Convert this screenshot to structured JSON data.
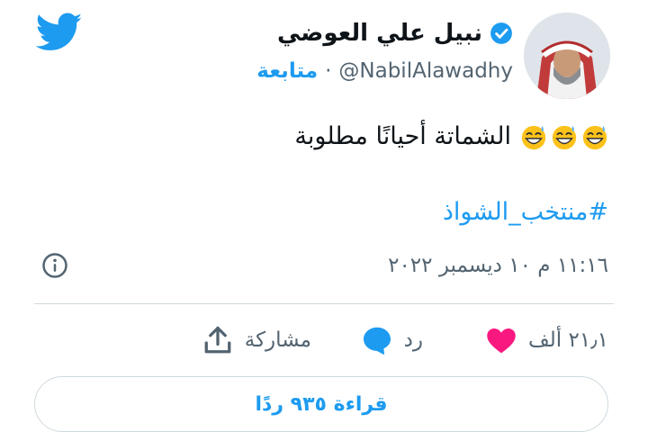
{
  "brand": {
    "icon": "twitter-bird-icon",
    "color": "#1d9bf0"
  },
  "author": {
    "name": "نبيل علي العوضي",
    "handle": "@NabilAlawadhy",
    "separator": "·",
    "follow_label": "متابعة",
    "verified": true,
    "verified_icon": "verified-badge-icon",
    "avatar": "profile-photo"
  },
  "tweet": {
    "text": "الشماتة أحيانًا مطلوبة",
    "emojis": [
      "grinning-sweat-emoji",
      "grinning-sweat-emoji",
      "grinning-sweat-emoji"
    ],
    "hashtag": "#منتخب_الشواذ",
    "timestamp": "١١:١٦ م ١٠ ديسمبر ٢٠٢٢",
    "info_icon": "info-icon"
  },
  "actions": {
    "likes": {
      "count": "٢١٫١ ألف",
      "icon": "heart-icon",
      "color": "#f91880"
    },
    "reply": {
      "label": "رد",
      "icon": "speech-bubble-icon"
    },
    "share": {
      "label": "مشاركة",
      "icon": "share-upload-icon"
    }
  },
  "read_replies_label": "قراءة ٩٣٥ ردًا"
}
